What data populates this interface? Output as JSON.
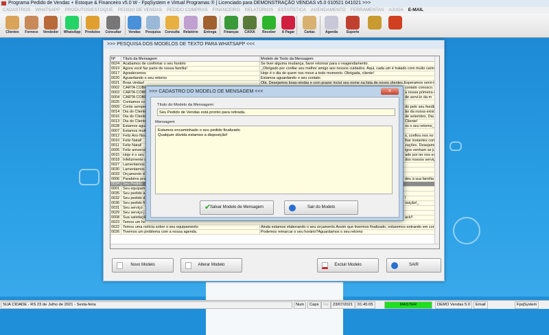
{
  "app": {
    "title": "Programa Pedido de Vendas + Estoque & Financeiro v5.0 W - FpqSystem e Virtual Programas ® | Licenciado para  DEMONSTRAÇÃO VENDAS v5.0 010521 041021 >>>"
  },
  "menu": [
    "CADASTROS",
    "WHATSAPP",
    "PRODUTOS/ESTOQUE",
    "PEDIDO DE VENDAS",
    "PEDIDO COMPRAS",
    "FINANCEIRO",
    "RELATÓRIOS",
    "ESTATÍSTICA",
    "AGENDAMENTO",
    "FERRAMENTAS",
    "AJUDA"
  ],
  "menu_email": "E-MAIL",
  "toolbar": [
    {
      "label": "Clientes",
      "icon": "clients-icon",
      "color": "#d9a35a"
    },
    {
      "label": "Fornece",
      "icon": "supplier-icon",
      "color": "#c98a5a"
    },
    {
      "label": "Vendedor",
      "icon": "seller-icon",
      "color": "#b86a3a"
    },
    {
      "label": "WhatsApp",
      "icon": "whatsapp-icon",
      "color": "#25d366"
    },
    {
      "label": "Produtos",
      "icon": "products-icon",
      "color": "#e0a030"
    },
    {
      "label": "Consultar",
      "icon": "consult-icon",
      "color": "#777777"
    },
    {
      "label": "Vendas",
      "icon": "monitor-icon",
      "color": "#4a90d9"
    },
    {
      "label": "Pesquisa",
      "icon": "search-icon",
      "color": "#9ab8d8"
    },
    {
      "label": "Consulta",
      "icon": "folder-icon",
      "color": "#e8b040"
    },
    {
      "label": "Relatório",
      "icon": "report-icon",
      "color": "#c0a0d0"
    },
    {
      "label": "Entrega",
      "icon": "delivery-icon",
      "color": "#a06030"
    },
    {
      "label": "Finanças",
      "icon": "finance-icon",
      "color": "#3a9a3a"
    },
    {
      "label": "CAIXA",
      "icon": "cashbox-icon",
      "color": "#5a7a3a"
    },
    {
      "label": "Receber",
      "icon": "receive-icon",
      "color": "#2db52d"
    },
    {
      "label": "A Pagar",
      "icon": "pay-icon",
      "color": "#d02040"
    },
    {
      "label": "Cartas",
      "icon": "letters-icon",
      "color": "#d8b070"
    },
    {
      "label": "Agenda",
      "icon": "agenda-icon",
      "color": "#c8c8d8"
    },
    {
      "label": "Suporte",
      "icon": "support-icon",
      "color": "#c04030"
    },
    {
      "label": "",
      "icon": "coins-icon",
      "color": "#c89a30"
    },
    {
      "label": "",
      "icon": "exit-icon",
      "color": "#d04020"
    }
  ],
  "main": {
    "title": ">>> PESQUISA DOS MODELOS DE TEXTO PARA WHATSAPP <<<",
    "columns": [
      "Nº",
      "Título da Mensagem",
      "Modelo de Texto da Mensagem"
    ],
    "rows": [
      [
        "0024",
        "Acabamos de confirmar o seu horário",
        "Se tiver alguma mudança, favor retornar para o reagendamento.",
        ""
      ],
      [
        "0019",
        "Agora você faz parte de nossa família!",
        "_Obrigado por confiar seu melhor amigo aos nossos cuidados. Aqui, cada um é tratado com muito carinho pa",
        ""
      ],
      [
        "0017",
        "Agradecemos",
        "Hoje é o dia de quem nos move a todo momento. Obrigada, cliente!",
        ""
      ],
      [
        "0020",
        "Aguardando o seu retorno",
        "Estamos aguardando o seu contato",
        ""
      ],
      [
        "0021",
        "Boas vindas!",
        "Olá. Desejamos boas-vindas e com prazer incluí seu nome na lista de novos clientes.Esperamos servi-los ca",
        ""
      ],
      [
        "0002",
        "CARTA COBR",
        "",
        "contato conosco."
      ],
      [
        "0003",
        "CARTA COBR",
        "",
        "a nossa primeira c"
      ],
      [
        "0004",
        "CARTA COBR",
        "",
        "de servi-lo da m"
      ],
      [
        "0025",
        "Contamos co",
        "",
        ""
      ],
      [
        "0009",
        "Conte sempre",
        "",
        "do pelo seu feedba"
      ],
      [
        "0014",
        "Dia do Cliente",
        "",
        "ão da nossa existê"
      ],
      [
        "0016",
        "Dia do Cliente",
        "",
        "de setembro, Dia d"
      ],
      [
        "0013",
        "Dia do Cliente",
        "",
        "Cliente!"
      ],
      [
        "0028",
        "Estamos agua",
        "",
        "os o seu retorno_"
      ],
      [
        "0007",
        "Estamos muit",
        "",
        ""
      ],
      [
        "0012",
        "Feliz Ano Nov",
        "",
        "s, confiou nos no"
      ],
      [
        "0010",
        "Feliz Natal!",
        "",
        "lhar instantes com"
      ],
      [
        "0011",
        "Feliz Natal!",
        "",
        "zações. Desejamo"
      ],
      [
        "0005",
        "Feliz aniversá",
        "",
        "igos venham se ju"
      ],
      [
        "0015",
        "Hoje é o seu",
        "",
        "ado por ter nos es"
      ],
      [
        "0018",
        "Infelizmente a",
        "",
        "dos nossos serviço"
      ],
      [
        "0027",
        "Lamentamos",
        "",
        ""
      ],
      [
        "0030",
        "Lamentamos",
        "",
        ""
      ],
      [
        "0033",
        "Orçamento d",
        "",
        ""
      ],
      [
        "0006",
        "Parabéns pra",
        "",
        "deu à sua família"
      ],
      [
        "0034",
        "Seu Pedido",
        "",
        ""
      ],
      [
        "0001",
        "Seu equipam",
        "",
        ""
      ],
      [
        "0035",
        "Seu pedido a",
        "",
        ""
      ],
      [
        "0032",
        "Seu pedido d",
        "",
        "!"
      ],
      [
        "0036",
        "Seu pedido fi",
        "",
        "osição!_"
      ],
      [
        "0031",
        "Seu serviço",
        "",
        ""
      ],
      [
        "0029",
        "Seu serviço j",
        "",
        ""
      ],
      [
        "0008",
        "Sua satisfaçã",
        "",
        "ack!!"
      ],
      [
        "0023",
        "Temos um ho",
        "",
        ""
      ],
      [
        "0022",
        "Temos uma notícia sobre o seu equipamento",
        "Ainda estamos elaborando o seu orçamento.Assim que tivermos finalizado, estaremos entrando em contato.",
        ""
      ],
      [
        "0026",
        "Tivemos um problema com a nossa agenda.",
        "Podemos remarcar o seu horário?Aguardamos o seu retorno",
        ""
      ]
    ],
    "selected_row": "0034",
    "buttons": {
      "novo": "Novo Modelo",
      "alterar": "Alterar Modelo",
      "excluir": "Excluir Modelo",
      "sair": "SAIR"
    }
  },
  "dialog": {
    "title": ">>> CADASTRO DO MODELO DE MENSAGEM <<<",
    "close": "x",
    "titulo_label": "Título do Modelo da Mensagem:",
    "titulo_value": "Seu Pedido de Vendas está pronto para retirada.",
    "mensagem_label": "Mensagem",
    "mensagem_value": "Estamos encaminhado o seu pedido finalizado\nQualquer dúvida estamos a disposição!",
    "save": "Salvar Modelo de Mensagem",
    "exit": "Sair do Modelo"
  },
  "status": {
    "city": "SUA CIDADE - RS 23 de Julho de 2021 - Sexta-feira",
    "num": "Num",
    "caps": "Caps",
    "ins": "Ins",
    "date": "23/07/2021",
    "time": "01:45:05",
    "user": "MASTER",
    "version": "DEMO Vendas 5.0",
    "email": "Email",
    "brand": "FpqSystem",
    "user_color": "#22dd22"
  }
}
